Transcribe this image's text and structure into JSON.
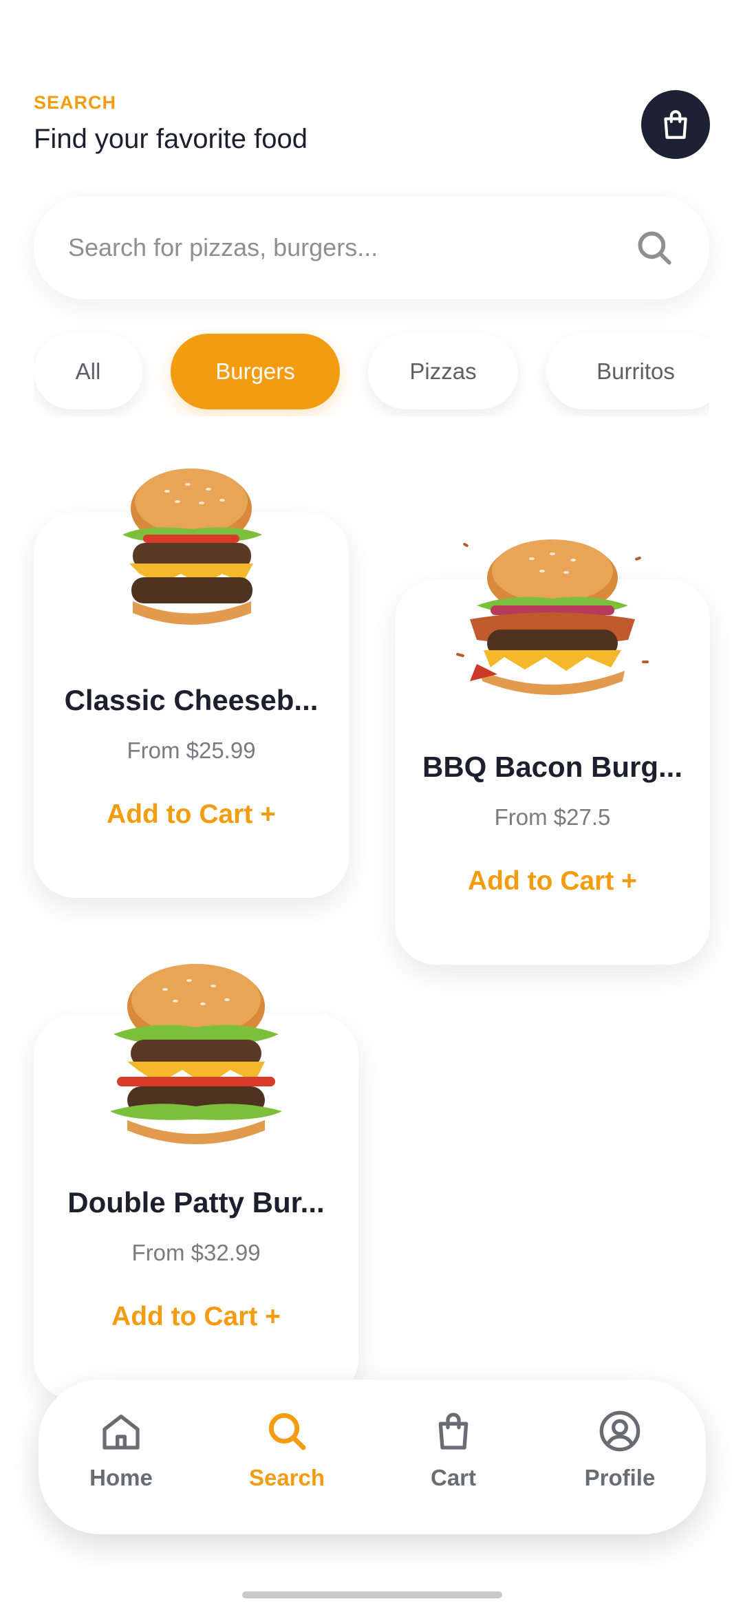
{
  "header": {
    "kicker": "SEARCH",
    "title": "Find your favorite food"
  },
  "search": {
    "placeholder": "Search for pizzas, burgers...",
    "value": ""
  },
  "categories": [
    {
      "label": "All",
      "active": false
    },
    {
      "label": "Burgers",
      "active": true
    },
    {
      "label": "Pizzas",
      "active": false
    },
    {
      "label": "Burritos",
      "active": false
    }
  ],
  "products": [
    {
      "name": "Classic Cheeseb...",
      "price": "From $25.99",
      "cta": "Add to Cart +"
    },
    {
      "name": "BBQ Bacon Burg...",
      "price": "From $27.5",
      "cta": "Add to Cart +"
    },
    {
      "name": "Double Patty Bur...",
      "price": "From $32.99",
      "cta": "Add to Cart +"
    }
  ],
  "nav": [
    {
      "label": "Home",
      "icon": "home-icon",
      "active": false
    },
    {
      "label": "Search",
      "icon": "search-icon",
      "active": true
    },
    {
      "label": "Cart",
      "icon": "shopping-bag-icon",
      "active": false
    },
    {
      "label": "Profile",
      "icon": "user-circle-icon",
      "active": false
    }
  ],
  "colors": {
    "accent": "#f39c12",
    "dark": "#1c2133",
    "text": "#1c1f2e",
    "muted": "#7a7a80"
  }
}
